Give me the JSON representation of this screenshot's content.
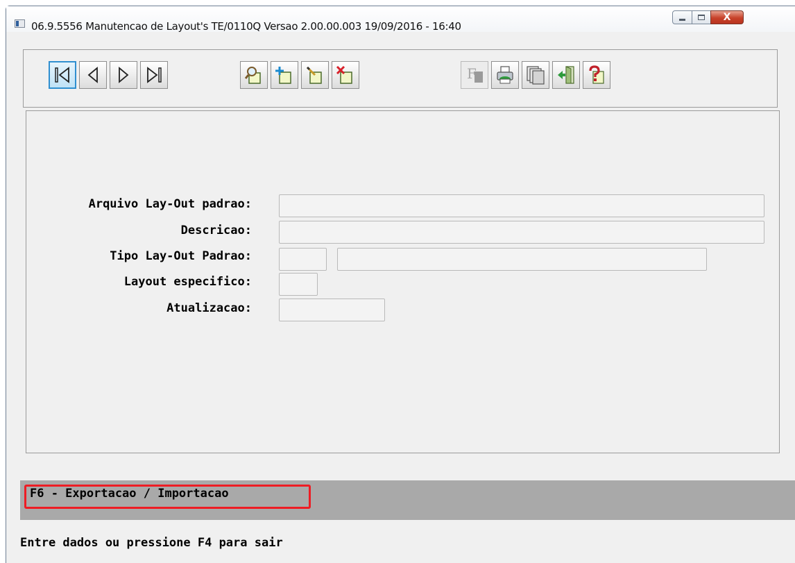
{
  "window": {
    "title": "06.9.5556 Manutencao  de Layout's TE/0110Q Versao 2.00.00.003 19/09/2016 - 16:40",
    "close_glyph": "X"
  },
  "toolbar": {
    "buttons": [
      {
        "name": "first-record",
        "icon": "first-icon"
      },
      {
        "name": "previous-record",
        "icon": "previous-icon"
      },
      {
        "name": "next-record",
        "icon": "next-icon"
      },
      {
        "name": "last-record",
        "icon": "last-icon"
      },
      {
        "name": "search",
        "icon": "search-icon"
      },
      {
        "name": "add",
        "icon": "add-icon"
      },
      {
        "name": "edit",
        "icon": "edit-icon"
      },
      {
        "name": "delete",
        "icon": "delete-icon"
      },
      {
        "name": "filter",
        "icon": "filter-icon",
        "disabled": true
      },
      {
        "name": "print",
        "icon": "print-icon"
      },
      {
        "name": "copy",
        "icon": "copy-icon"
      },
      {
        "name": "exit",
        "icon": "exit-icon"
      },
      {
        "name": "help",
        "icon": "help-icon"
      }
    ],
    "filter_glyph": "F"
  },
  "form": {
    "arquivo_label": "Arquivo Lay-Out padrao:",
    "arquivo_value": "",
    "descricao_label": "Descricao:",
    "descricao_value": "",
    "tipo_label": "Tipo Lay-Out Padrao:",
    "tipo_code": "",
    "tipo_desc": "",
    "layout_esp_label": "Layout especifico:",
    "layout_esp_value": "",
    "atualizacao_label": "Atualizacao:",
    "atualizacao_value": ""
  },
  "function_keys": {
    "f6_label": "F6 - Exportacao / Importacao"
  },
  "status_bar": {
    "message": "Entre dados ou pressione F4 para sair"
  },
  "colors": {
    "highlight_border": "#ee1c24",
    "fkey_bar_background": "#a9a9a9",
    "window_background": "#f0f0f0"
  }
}
